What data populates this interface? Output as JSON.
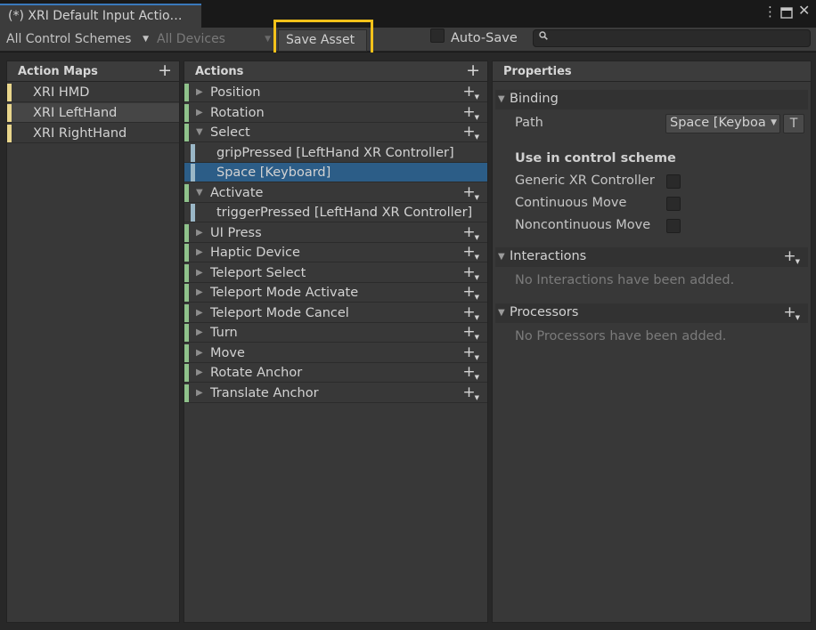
{
  "window": {
    "tab_title": "(*) XRI Default Input Actio…",
    "menu_icon": "kebab-menu-icon",
    "maximize_icon": "maximize-icon",
    "close_icon": "close-icon"
  },
  "toolbar": {
    "control_scheme": "All Control Schemes",
    "devices": "All Devices",
    "save_label": "Save Asset",
    "auto_save_label": "Auto-Save",
    "auto_save_checked": false,
    "search_value": "",
    "search_icon": "search-icon"
  },
  "action_maps": {
    "header": "Action Maps",
    "items": [
      {
        "label": "XRI HMD",
        "selected": false
      },
      {
        "label": "XRI LeftHand",
        "selected": true
      },
      {
        "label": "XRI RightHand",
        "selected": false
      }
    ]
  },
  "actions": {
    "header": "Actions",
    "items": [
      {
        "label": "Position",
        "kind": "action",
        "expanded": false
      },
      {
        "label": "Rotation",
        "kind": "action",
        "expanded": false
      },
      {
        "label": "Select",
        "kind": "action",
        "expanded": true
      },
      {
        "label": "gripPressed [LeftHand XR Controller]",
        "kind": "binding",
        "selected": false
      },
      {
        "label": "Space [Keyboard]",
        "kind": "binding",
        "selected": true
      },
      {
        "label": "Activate",
        "kind": "action",
        "expanded": true
      },
      {
        "label": "triggerPressed [LeftHand XR Controller]",
        "kind": "binding",
        "selected": false
      },
      {
        "label": "UI Press",
        "kind": "action",
        "expanded": false
      },
      {
        "label": "Haptic Device",
        "kind": "action",
        "expanded": false
      },
      {
        "label": "Teleport Select",
        "kind": "action",
        "expanded": false
      },
      {
        "label": "Teleport Mode Activate",
        "kind": "action",
        "expanded": false
      },
      {
        "label": "Teleport Mode Cancel",
        "kind": "action",
        "expanded": false
      },
      {
        "label": "Turn",
        "kind": "action",
        "expanded": false
      },
      {
        "label": "Move",
        "kind": "action",
        "expanded": false
      },
      {
        "label": "Rotate Anchor",
        "kind": "action",
        "expanded": false
      },
      {
        "label": "Translate Anchor",
        "kind": "action",
        "expanded": false
      }
    ]
  },
  "properties": {
    "header": "Properties",
    "binding": {
      "title": "Binding",
      "path_label": "Path",
      "path_value": "Space [Keyboa",
      "t_button": "T",
      "scheme_heading": "Use in control scheme",
      "schemes": [
        {
          "label": "Generic XR Controller",
          "checked": false
        },
        {
          "label": "Continuous Move",
          "checked": false
        },
        {
          "label": "Noncontinuous Move",
          "checked": false
        }
      ]
    },
    "interactions": {
      "title": "Interactions",
      "empty_text": "No Interactions have been added."
    },
    "processors": {
      "title": "Processors",
      "empty_text": "No Processors have been added."
    }
  },
  "colors": {
    "accent_highlight": "#f5c21a",
    "map_bar": "#e9d68c",
    "action_bar": "#8fc28b",
    "binding_bar": "#9ab7c7",
    "selection": "#2c5d87"
  }
}
